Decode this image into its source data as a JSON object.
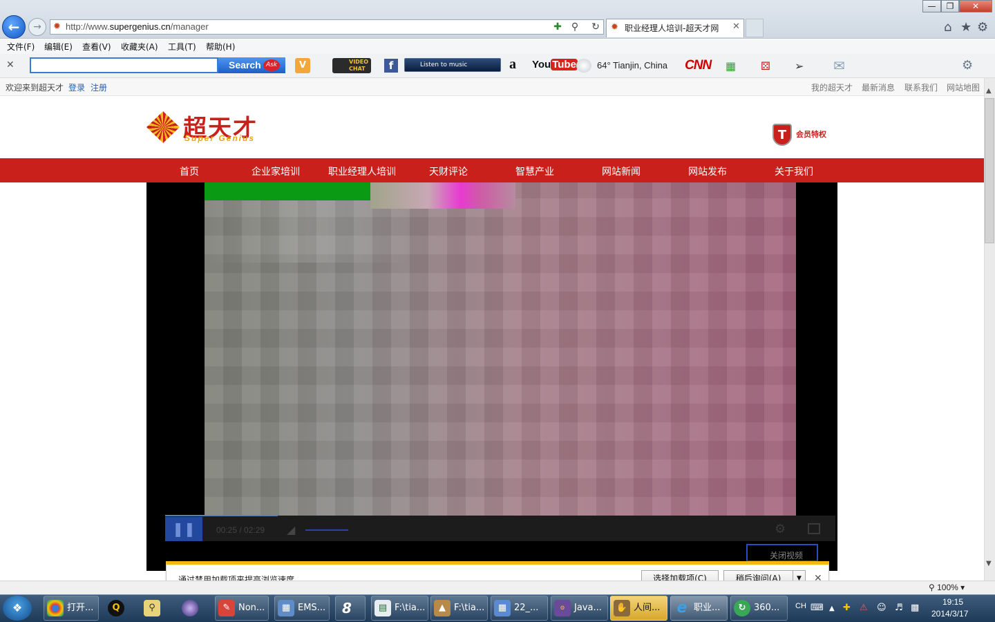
{
  "browser": {
    "url_prefix": "http://www.",
    "url_domain": "supergenius.cn",
    "url_path": "/manager",
    "tab_title": "职业经理人培训-超天才网",
    "menu": [
      "文件(F)",
      "编辑(E)",
      "查看(V)",
      "收藏夹(A)",
      "工具(T)",
      "帮助(H)"
    ],
    "zoom": "100%"
  },
  "toolbar": {
    "search_label": "Search",
    "ask_logo": "Ask",
    "video_chat": "VIDEO CHAT",
    "music_label": "Listen to music",
    "weather": "64° Tianjin, China",
    "cnn": "CNN",
    "amazon": "a",
    "youtube_you": "You",
    "youtube_tube": "Tube"
  },
  "topbar": {
    "welcome": "欢迎来到超天才",
    "login": "登录",
    "register": "注册",
    "links": [
      "我的超天才",
      "最新消息",
      "联系我们",
      "网站地图"
    ]
  },
  "site": {
    "logo_cn": "超天才",
    "logo_en": "Super Genius",
    "member_badge": "T",
    "member_text": "会员特权",
    "nav": [
      "首页",
      "企业家培训",
      "职业经理人培训",
      "天财评论",
      "智慧产业",
      "网站新闻",
      "网站发布",
      "关于我们"
    ]
  },
  "video": {
    "current_time": "00:25",
    "total_time": "02:29",
    "progress": 0.168,
    "close_label": "关闭视频"
  },
  "notification": {
    "text": "通过禁用加载项来提高浏览速度。",
    "choose_label": "选择加载项(C)",
    "later_label": "稍后询问(A)"
  },
  "taskbar": {
    "items": [
      {
        "label": "打开...",
        "icon": "chrome-icon"
      },
      {
        "label": "",
        "icon": "qq-icon"
      },
      {
        "label": "",
        "icon": "search-people-icon"
      },
      {
        "label": "",
        "icon": "eclipse-icon"
      },
      {
        "label": "Non...",
        "icon": "eraser-icon"
      },
      {
        "label": "EMS...",
        "icon": "ems-icon"
      },
      {
        "label": "",
        "icon": "music-icon"
      },
      {
        "label": "F:\\tia...",
        "icon": "explorer-icon"
      },
      {
        "label": "F:\\tia...",
        "icon": "fox-icon"
      },
      {
        "label": "22_...",
        "icon": "app-icon"
      },
      {
        "label": "Java...",
        "icon": "java-ide-icon"
      },
      {
        "label": "人间...",
        "icon": "handshake-icon"
      },
      {
        "label": "职业...",
        "icon": "ie-icon"
      },
      {
        "label": "360...",
        "icon": "360-icon"
      }
    ],
    "lang": "CH",
    "time": "19:15",
    "date": "2014/3/17"
  }
}
